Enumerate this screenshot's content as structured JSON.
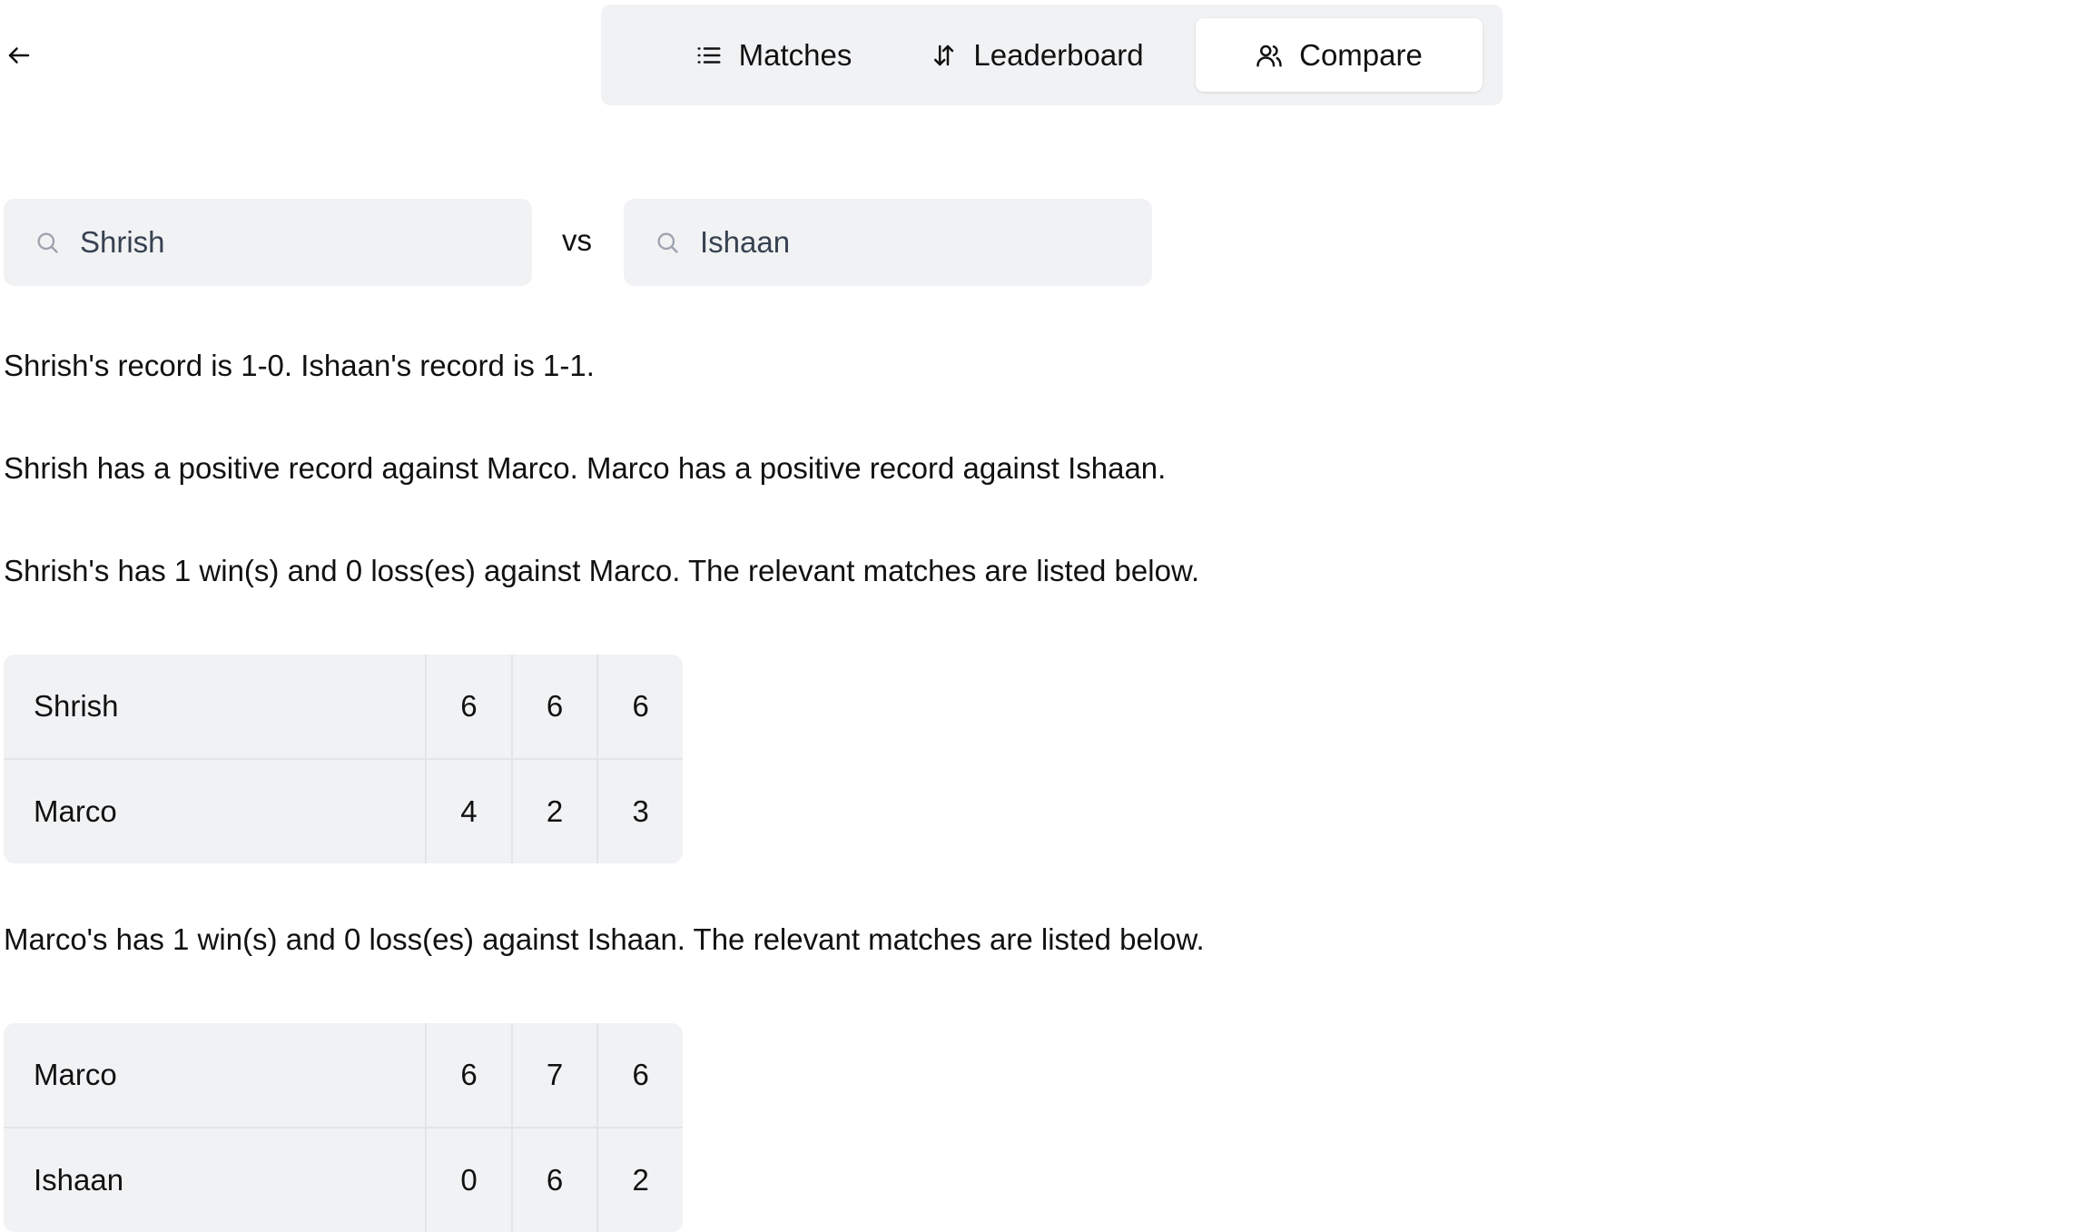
{
  "nav": {
    "back_icon": "arrow-left-icon",
    "tabs": [
      {
        "label": "Matches",
        "icon": "list-icon",
        "active": false
      },
      {
        "label": "Leaderboard",
        "icon": "sort-arrows-icon",
        "active": false
      },
      {
        "label": "Compare",
        "icon": "users-icon",
        "active": true
      }
    ]
  },
  "compare": {
    "player1": {
      "value": "Shrish",
      "icon": "search-icon"
    },
    "vs_label": "vs",
    "player2": {
      "value": "Ishaan",
      "icon": "search-icon"
    }
  },
  "summary": {
    "records": "Shrish's record is 1-0. Ishaan's record is 1-1.",
    "chain": "Shrish has a positive record against Marco. Marco has a positive record against Ishaan."
  },
  "sections": [
    {
      "text": "Shrish's has 1 win(s) and 0 loss(es) against Marco. The relevant matches are listed below.",
      "rows": [
        {
          "name": "Shrish",
          "scores": [
            "6",
            "6",
            "6"
          ]
        },
        {
          "name": "Marco",
          "scores": [
            "4",
            "2",
            "3"
          ]
        }
      ]
    },
    {
      "text": "Marco's has 1 win(s) and 0 loss(es) against Ishaan. The relevant matches are listed below.",
      "rows": [
        {
          "name": "Marco",
          "scores": [
            "6",
            "7",
            "6"
          ]
        },
        {
          "name": "Ishaan",
          "scores": [
            "0",
            "6",
            "2"
          ]
        }
      ]
    }
  ],
  "colors": {
    "surface": "#f1f2f4",
    "active_tab": "#ffffff",
    "text": "#111111",
    "divider": "#e2e4e8"
  }
}
